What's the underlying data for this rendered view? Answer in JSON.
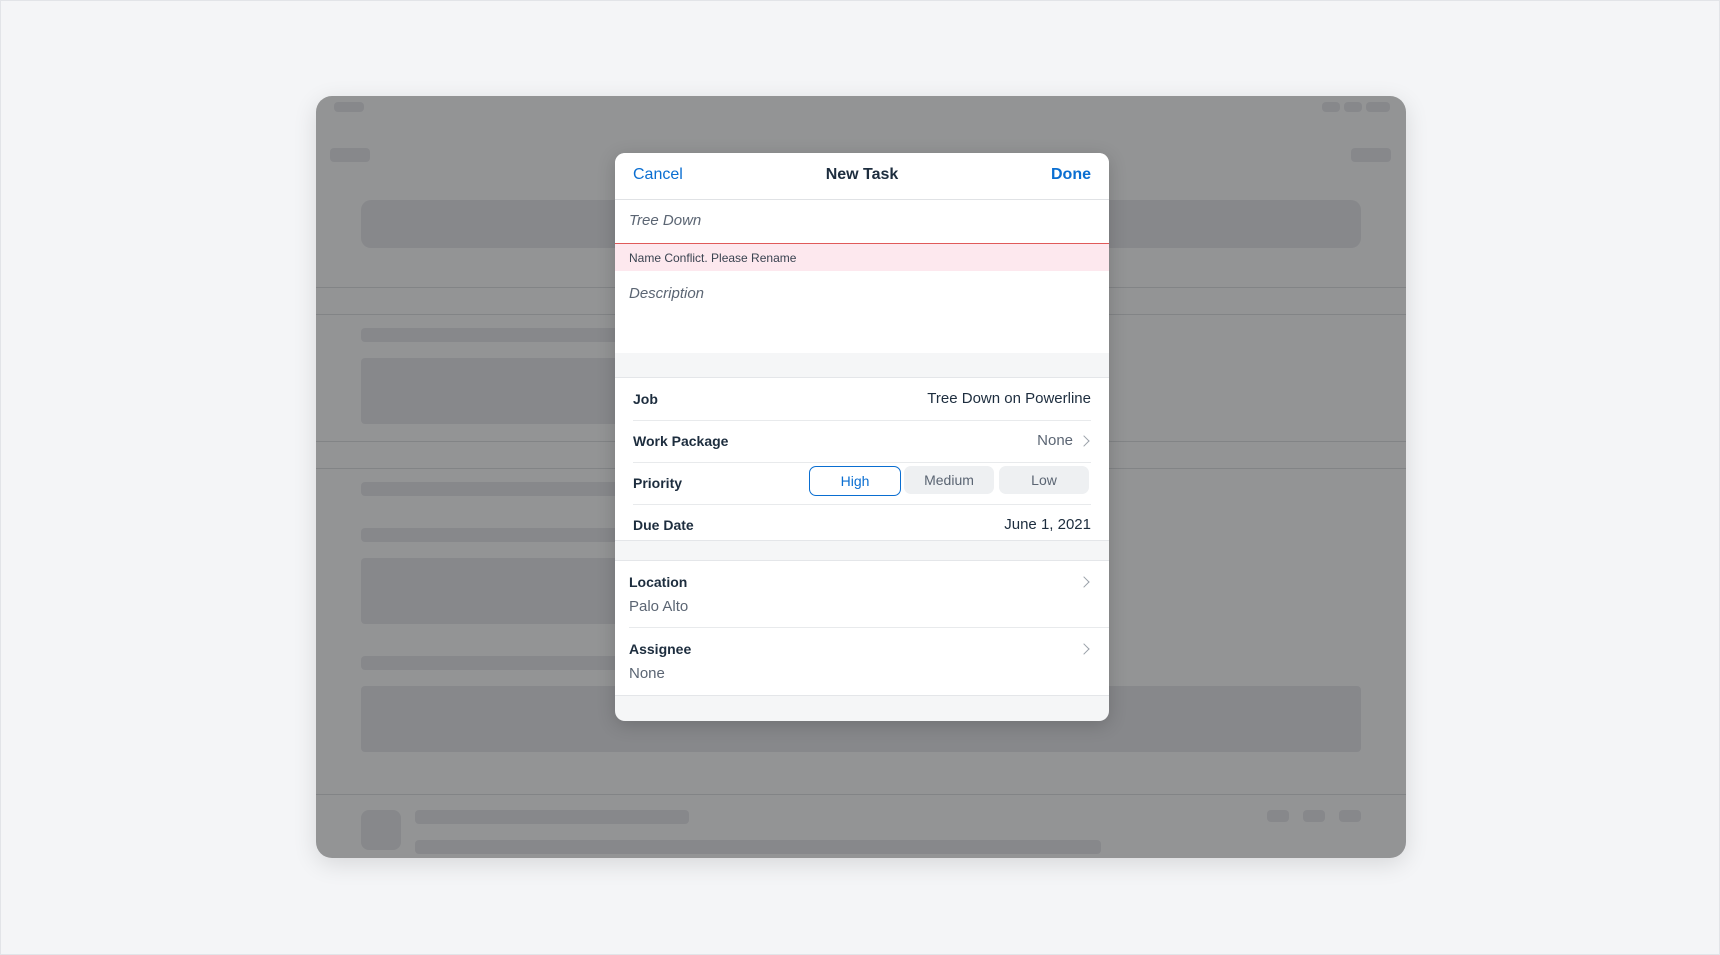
{
  "modal": {
    "header": {
      "cancel_label": "Cancel",
      "title": "New Task",
      "done_label": "Done"
    },
    "name_field": {
      "value": "Tree Down"
    },
    "error_message": "Name Conflict. Please Rename",
    "description_field": {
      "placeholder": "Description"
    },
    "details": {
      "job": {
        "label": "Job",
        "value": "Tree Down on Powerline"
      },
      "work_package": {
        "label": "Work Package",
        "value": "None"
      },
      "priority": {
        "label": "Priority",
        "options": [
          "High",
          "Medium",
          "Low"
        ],
        "selected": "High"
      },
      "due_date": {
        "label": "Due Date",
        "value": "June 1, 2021"
      }
    },
    "navigation_items": [
      {
        "label": "Location",
        "value": "Palo Alto"
      },
      {
        "label": "Assignee",
        "value": "None"
      }
    ]
  },
  "colors": {
    "accent": "#0a6ed1",
    "error_background": "#fde8ee",
    "error_border": "#e05a5a",
    "page_background": "#f4f5f7"
  }
}
